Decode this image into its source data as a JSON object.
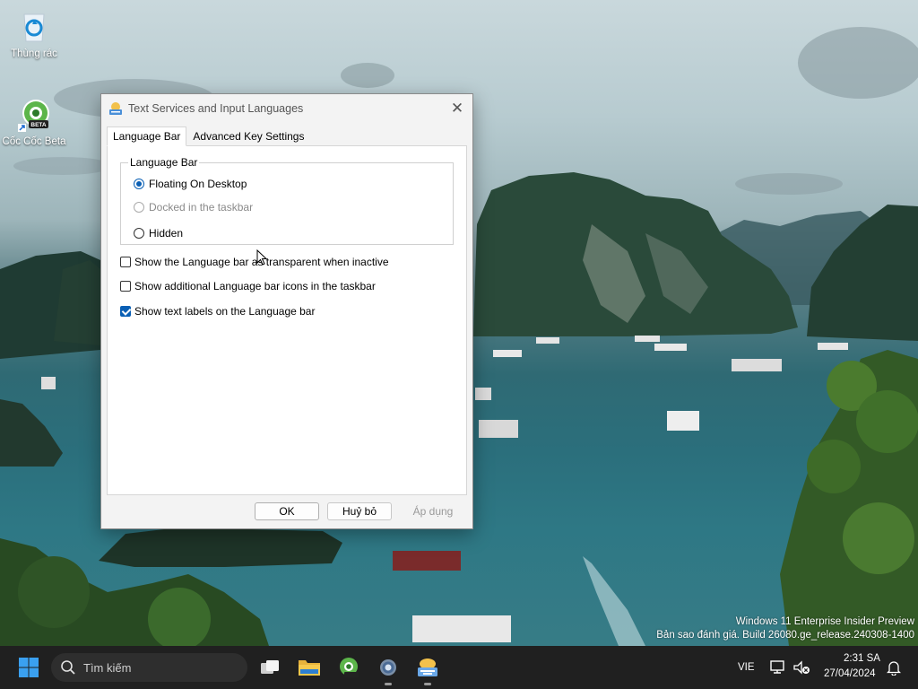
{
  "desktop": {
    "icons": [
      {
        "label": "Thùng rác"
      },
      {
        "label": "Cốc Cốc Beta"
      }
    ]
  },
  "dialog": {
    "title": "Text Services and Input Languages",
    "tabs": [
      {
        "label": "Language Bar",
        "active": true
      },
      {
        "label": "Advanced Key Settings",
        "active": false
      }
    ],
    "groupbox_label": "Language Bar",
    "radios": [
      {
        "label": "Floating On Desktop",
        "selected": true,
        "enabled": true
      },
      {
        "label": "Docked in the taskbar",
        "selected": false,
        "enabled": false
      },
      {
        "label": "Hidden",
        "selected": false,
        "enabled": true
      }
    ],
    "checkboxes": [
      {
        "label": "Show the Language bar as transparent when inactive",
        "checked": false
      },
      {
        "label": "Show additional Language bar icons in the taskbar",
        "checked": false
      },
      {
        "label": "Show text labels on the Language bar",
        "checked": true
      }
    ],
    "buttons": {
      "ok": "OK",
      "cancel": "Huỷ bỏ",
      "apply": "Áp dụng"
    }
  },
  "watermark": {
    "line1": "Windows 11 Enterprise Insider Preview",
    "line2": "Bản sao đánh giá. Build 26080.ge_release.240308-1400"
  },
  "taskbar": {
    "search_placeholder": "Tìm kiếm",
    "language": "VIE",
    "time": "2:31 SA",
    "date": "27/04/2024"
  },
  "colors": {
    "accent": "#0a5fb4",
    "taskbar_bg": "#202020",
    "dialog_bg": "#f3f3f3"
  }
}
